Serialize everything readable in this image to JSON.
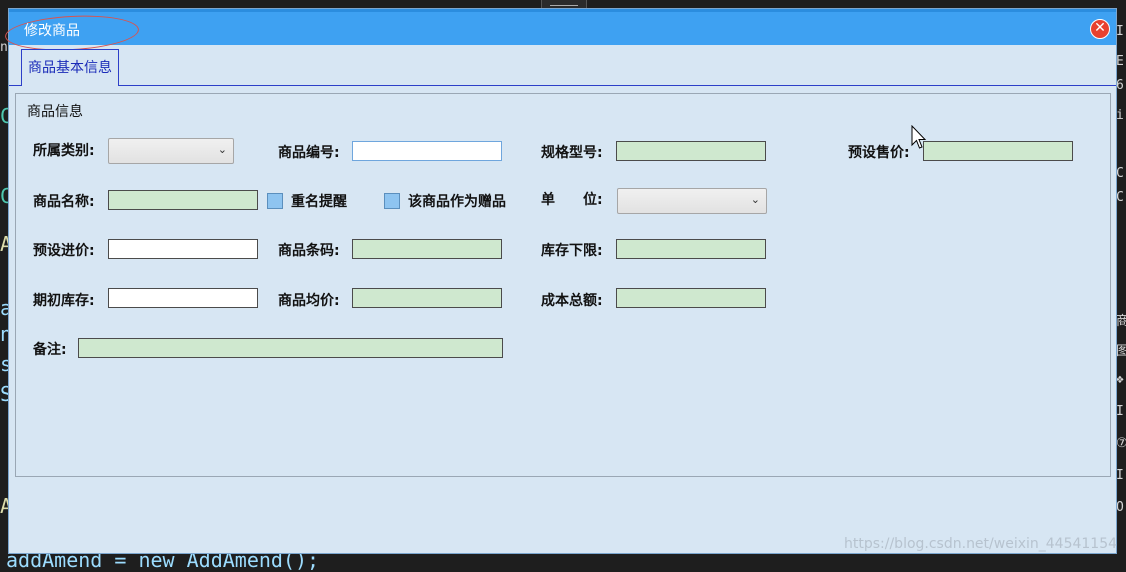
{
  "background": {
    "code_line": "addAmend = new AddAmend();",
    "left_chars": [
      "n",
      "C",
      "C",
      "A",
      "a",
      "n",
      "s",
      "S",
      "A"
    ],
    "right_chars": [
      "I",
      "E",
      "6",
      "i",
      "C",
      "C",
      "商",
      "图",
      "❖",
      "I",
      "⑦",
      "I",
      "O"
    ]
  },
  "window": {
    "title": "修改商品",
    "close_glyph": "✕",
    "tab_label": "商品基本信息",
    "group_title": "商品信息"
  },
  "form": {
    "category_label": "所属类别:",
    "code_label": "商品编号:",
    "spec_label": "规格型号:",
    "sale_price_label": "预设售价:",
    "name_label": "商品名称:",
    "dup_check_label": "重名提醒",
    "gift_label": "该商品作为赠品",
    "unit_label": "单　　位:",
    "purchase_price_label": "预设进价:",
    "barcode_label": "商品条码:",
    "stock_min_label": "库存下限:",
    "initial_stock_label": "期初库存:",
    "avg_price_label": "商品均价:",
    "total_cost_label": "成本总额:",
    "remark_label": "备注:",
    "dropdown_arrow": "⌄"
  },
  "colors": {
    "titlebar": "#3ea1f2",
    "window_bg": "#d7e6f3",
    "readonly_field": "#cfe8cf",
    "tab_accent": "#2d3fc8",
    "close": "#e8412f"
  },
  "watermark": "https://blog.csdn.net/weixin_44541154"
}
